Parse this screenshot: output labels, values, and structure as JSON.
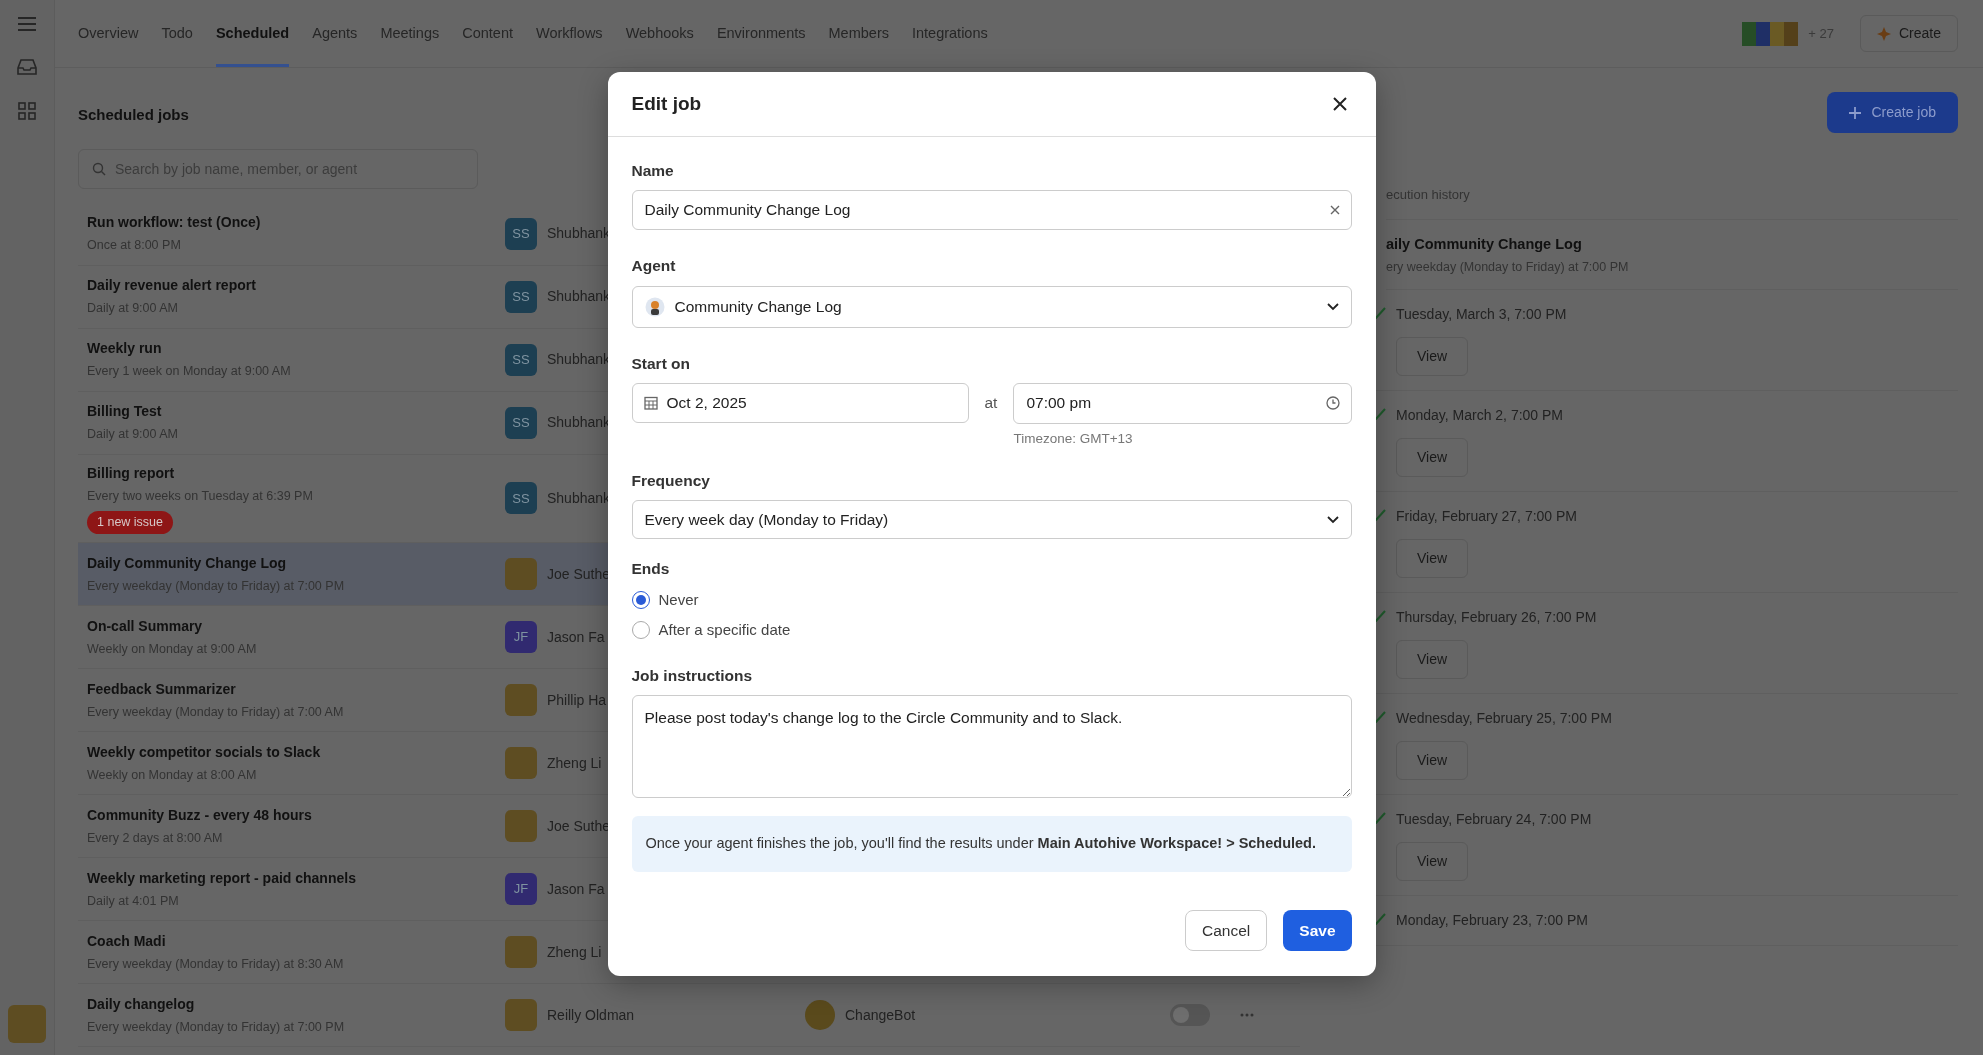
{
  "nav": {
    "tabs": [
      {
        "label": "Overview",
        "selected": false
      },
      {
        "label": "Todo",
        "selected": false
      },
      {
        "label": "Scheduled",
        "selected": true
      },
      {
        "label": "Agents",
        "selected": false
      },
      {
        "label": "Meetings",
        "selected": false
      },
      {
        "label": "Content",
        "selected": false
      },
      {
        "label": "Workflows",
        "selected": false
      },
      {
        "label": "Webhooks",
        "selected": false
      },
      {
        "label": "Environments",
        "selected": false
      },
      {
        "label": "Members",
        "selected": false
      },
      {
        "label": "Integrations",
        "selected": false
      }
    ],
    "member_count": "+ 27",
    "create_button": "Create"
  },
  "page": {
    "title": "Scheduled jobs",
    "search": {
      "placeholder": "Search by job name, member, or agent"
    },
    "create_job_button": "Create job"
  },
  "jobs": [
    {
      "title": "Run workflow: test (Once)",
      "schedule": "Once at 8:00 PM",
      "selected": false,
      "owner": {
        "kind": "initials",
        "initials": "SS",
        "color": "#1d3f52",
        "name": "Shubhank"
      }
    },
    {
      "title": "Daily revenue alert report",
      "schedule": "Daily at 9:00 AM",
      "selected": false,
      "owner": {
        "kind": "initials",
        "initials": "SS",
        "color": "#1d3f52",
        "name": "Shubhank"
      }
    },
    {
      "title": "Weekly run",
      "schedule": "Every 1 week on Monday at 9:00 AM",
      "selected": false,
      "owner": {
        "kind": "initials",
        "initials": "SS",
        "color": "#1d3f52",
        "name": "Shubhank"
      }
    },
    {
      "title": "Billing Test",
      "schedule": "Daily at 9:00 AM",
      "selected": false,
      "owner": {
        "kind": "initials",
        "initials": "SS",
        "color": "#1d3f52",
        "name": "Shubhank"
      }
    },
    {
      "title": "Billing report",
      "schedule": "Every two weeks on Tuesday at 6:39 PM",
      "badge": "1 new issue",
      "selected": false,
      "owner": {
        "kind": "initials",
        "initials": "SS",
        "color": "#1d3f52",
        "name": "Shubhank"
      }
    },
    {
      "title": "Daily Community Change Log",
      "schedule": "Every weekday (Monday to Friday) at 7:00 PM",
      "selected": true,
      "owner": {
        "kind": "photo",
        "name": "Joe Suthe"
      }
    },
    {
      "title": "On-call Summary",
      "schedule": "Weekly on Monday at 9:00 AM",
      "selected": false,
      "owner": {
        "kind": "initials",
        "initials": "JF",
        "color": "#312a70",
        "name": "Jason Fa"
      }
    },
    {
      "title": "Feedback Summarizer",
      "schedule": "Every weekday (Monday to Friday) at 7:00 AM",
      "selected": false,
      "owner": {
        "kind": "photo",
        "name": "Phillip Ha"
      }
    },
    {
      "title": "Weekly competitor socials to Slack",
      "schedule": "Weekly on Monday at 8:00 AM",
      "selected": false,
      "owner": {
        "kind": "photo",
        "name": "Zheng Li"
      }
    },
    {
      "title": "Community Buzz - every 48 hours",
      "schedule": "Every 2 days at 8:00 AM",
      "selected": false,
      "owner": {
        "kind": "photo",
        "name": "Joe Suthe"
      }
    },
    {
      "title": "Weekly marketing report - paid channels",
      "schedule": "Daily at 4:01 PM",
      "selected": false,
      "owner": {
        "kind": "initials",
        "initials": "JF",
        "color": "#312a70",
        "name": "Jason Fa"
      }
    },
    {
      "title": "Coach Madi",
      "schedule": "Every weekday (Monday to Friday) at 8:30 AM",
      "selected": false,
      "owner": {
        "kind": "photo",
        "name": "Zheng Li"
      }
    },
    {
      "title": "Daily changelog",
      "schedule": "Every weekday (Monday to Friday) at 7:00 PM",
      "selected": false,
      "owner": {
        "kind": "photo",
        "name": "Reilly Oldman"
      },
      "agent": "ChangeBot",
      "enabled": false
    }
  ],
  "history": {
    "title": "ecution history",
    "job_title": "aily Community Change Log",
    "job_schedule": "ery weekday (Monday to Friday) at 7:00 PM",
    "runs": [
      {
        "time": "Tuesday, March 3, 7:00 PM",
        "button": "View"
      },
      {
        "time": "Monday, March 2, 7:00 PM",
        "button": "View"
      },
      {
        "time": "Friday, February 27, 7:00 PM",
        "button": "View"
      },
      {
        "time": "Thursday, February 26, 7:00 PM",
        "button": "View"
      },
      {
        "time": "Wednesday, February 25, 7:00 PM",
        "button": "View"
      },
      {
        "time": "Tuesday, February 24, 7:00 PM",
        "button": "View"
      },
      {
        "time": "Monday, February 23, 7:00 PM"
      }
    ]
  },
  "modal": {
    "title": "Edit job",
    "name": {
      "label": "Name",
      "value": "Daily Community Change Log"
    },
    "agent": {
      "label": "Agent",
      "value": "Community Change Log"
    },
    "start": {
      "label": "Start on",
      "date": "Oct 2, 2025",
      "at": "at",
      "time": "07:00 pm",
      "timezone": "Timezone: GMT+13"
    },
    "frequency": {
      "label": "Frequency",
      "value": "Every week day (Monday to Friday)"
    },
    "ends": {
      "label": "Ends",
      "options": [
        {
          "label": "Never",
          "selected": true
        },
        {
          "label": "After a specific date",
          "selected": false
        }
      ]
    },
    "instructions": {
      "label": "Job instructions",
      "value": "Please post today's change log to the Circle Community and to Slack."
    },
    "info": "Once your agent finishes the job, you'll find the results under **Main Autohive Workspace! > Scheduled.**",
    "buttons": {
      "cancel": "Cancel",
      "save": "Save"
    }
  }
}
